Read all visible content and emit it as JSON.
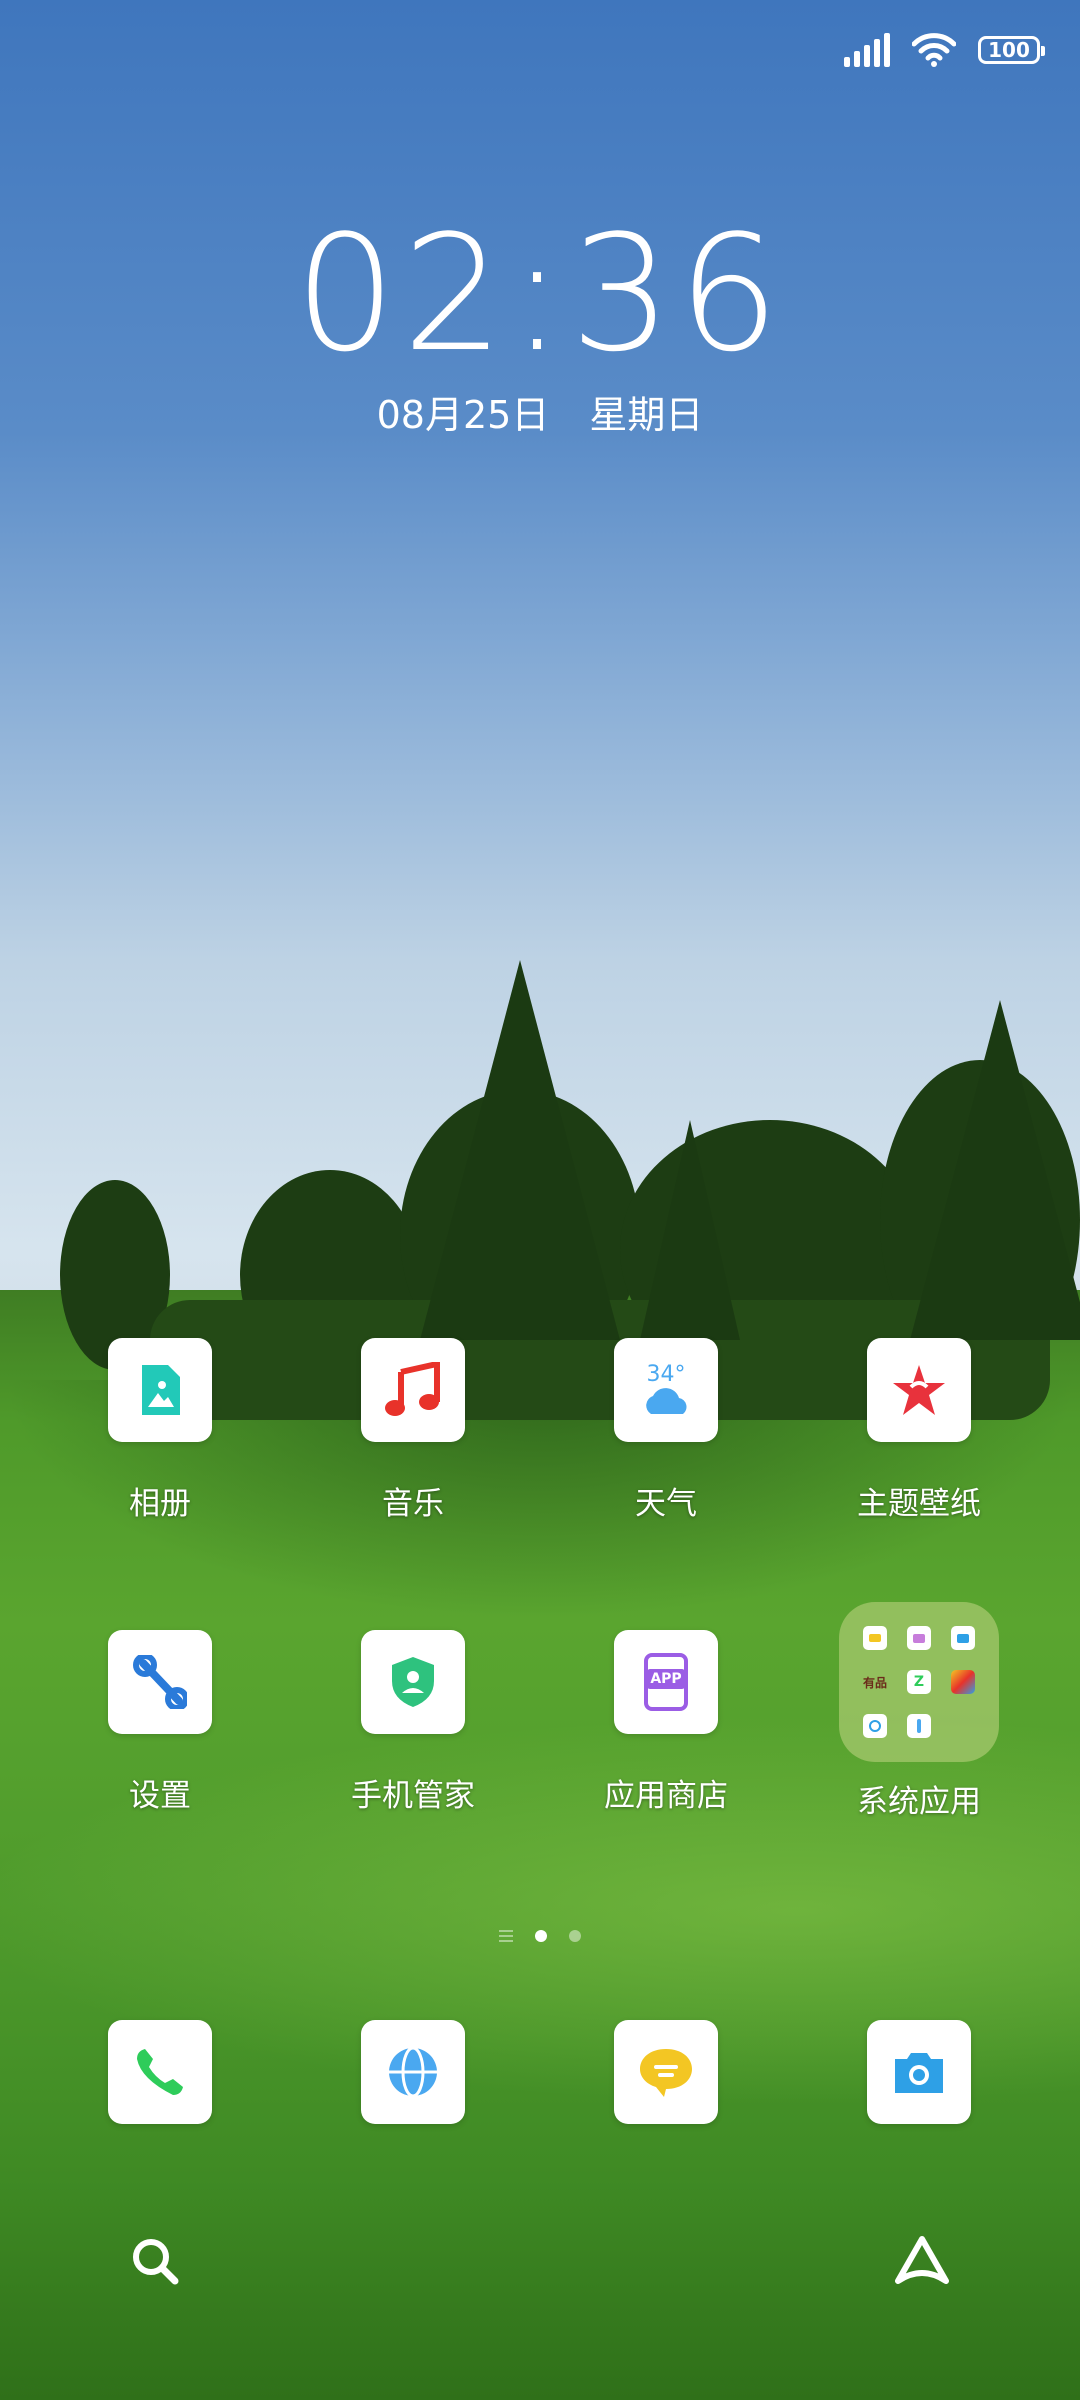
{
  "status": {
    "battery": "100"
  },
  "clock": {
    "time": "02:36",
    "date": "08月25日",
    "weekday": "星期日"
  },
  "home": {
    "row1": [
      {
        "label": "相册",
        "icon": "gallery-icon"
      },
      {
        "label": "音乐",
        "icon": "music-icon"
      },
      {
        "label": "天气",
        "icon": "weather-icon",
        "temp": "34°"
      },
      {
        "label": "主题壁纸",
        "icon": "theme-icon"
      }
    ],
    "row2": [
      {
        "label": "设置",
        "icon": "settings-icon"
      },
      {
        "label": "手机管家",
        "icon": "security-icon"
      },
      {
        "label": "应用商店",
        "icon": "app-store-icon",
        "badge": "APP"
      },
      {
        "label": "系统应用",
        "icon": "folder-icon",
        "mini_text": "有品"
      }
    ]
  },
  "dock": [
    "phone-icon",
    "browser-icon",
    "messages-icon",
    "camera-icon"
  ],
  "page_indicator": {
    "pages": 2,
    "current": 1
  },
  "colors": {
    "music": "#e8322a",
    "settings": "#2a7ad9",
    "security": "#2ec27e",
    "store": "#9b5de5",
    "theme": "#e8323c",
    "weather": "#4aa8f0",
    "messages": "#f3c623",
    "camera": "#2ea0e6",
    "phone": "#2ecc5a",
    "browser": "#4aa8f0"
  }
}
